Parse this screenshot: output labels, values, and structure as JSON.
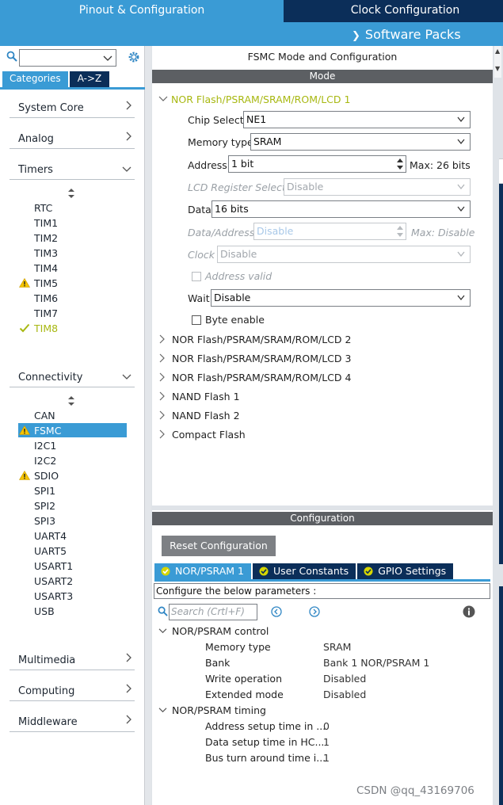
{
  "top_tabs": {
    "pinout": "Pinout & Configuration",
    "clock": "Clock Configuration",
    "software_packs": "Software Packs"
  },
  "left_panel": {
    "category_tabs": [
      "Categories",
      "A->Z"
    ],
    "categories": {
      "system_core": "System Core",
      "analog": "Analog",
      "timers": "Timers",
      "connectivity": "Connectivity",
      "multimedia": "Multimedia",
      "computing": "Computing",
      "middleware": "Middleware"
    },
    "timers": [
      {
        "name": "RTC",
        "status": "none"
      },
      {
        "name": "TIM1",
        "status": "none"
      },
      {
        "name": "TIM2",
        "status": "none"
      },
      {
        "name": "TIM3",
        "status": "none"
      },
      {
        "name": "TIM4",
        "status": "none"
      },
      {
        "name": "TIM5",
        "status": "warning"
      },
      {
        "name": "TIM6",
        "status": "none"
      },
      {
        "name": "TIM7",
        "status": "none"
      },
      {
        "name": "TIM8",
        "status": "ok"
      }
    ],
    "connectivity": [
      {
        "name": "CAN",
        "status": "none"
      },
      {
        "name": "FSMC",
        "status": "warning",
        "selected": true
      },
      {
        "name": "I2C1",
        "status": "none"
      },
      {
        "name": "I2C2",
        "status": "none"
      },
      {
        "name": "SDIO",
        "status": "warning"
      },
      {
        "name": "SPI1",
        "status": "none"
      },
      {
        "name": "SPI2",
        "status": "none"
      },
      {
        "name": "SPI3",
        "status": "none"
      },
      {
        "name": "UART4",
        "status": "none"
      },
      {
        "name": "UART5",
        "status": "none"
      },
      {
        "name": "USART1",
        "status": "none"
      },
      {
        "name": "USART2",
        "status": "none"
      },
      {
        "name": "USART3",
        "status": "none"
      },
      {
        "name": "USB",
        "status": "none"
      }
    ]
  },
  "mode": {
    "title": "FSMC Mode and Configuration",
    "bar": "Mode",
    "nor1": "NOR Flash/PSRAM/SRAM/ROM/LCD 1",
    "chip_select": {
      "label": "Chip Select",
      "value": "NE1"
    },
    "memory_type": {
      "label": "Memory type",
      "value": "SRAM"
    },
    "address": {
      "label": "Address",
      "value": "1 bit",
      "max": "Max: 26 bits"
    },
    "lcd_register_select": {
      "label": "LCD Register Select",
      "value": "Disable"
    },
    "data": {
      "label": "Data",
      "value": "16 bits"
    },
    "data_address": {
      "label": "Data/Address",
      "value": "Disable",
      "max": "Max: Disable"
    },
    "clock": {
      "label": "Clock",
      "value": "Disable"
    },
    "address_valid": {
      "label": "Address valid"
    },
    "wait": {
      "label": "Wait",
      "value": "Disable"
    },
    "byte_enable": {
      "label": "Byte enable"
    },
    "collapsed": [
      "NOR Flash/PSRAM/SRAM/ROM/LCD 2",
      "NOR Flash/PSRAM/SRAM/ROM/LCD 3",
      "NOR Flash/PSRAM/SRAM/ROM/LCD 4",
      "NAND Flash 1",
      "NAND Flash 2",
      "Compact Flash"
    ]
  },
  "config": {
    "bar": "Configuration",
    "reset": "Reset Configuration",
    "tabs": [
      "NOR/PSRAM 1",
      "User Constants",
      "GPIO Settings"
    ],
    "hint": "Configure the below parameters :",
    "search_placeholder": "Search (Crtl+F)",
    "groups": [
      {
        "name": "NOR/PSRAM control",
        "props": [
          {
            "k": "Memory type",
            "v": "SRAM"
          },
          {
            "k": "Bank",
            "v": "Bank 1 NOR/PSRAM 1"
          },
          {
            "k": "Write operation",
            "v": "Disabled"
          },
          {
            "k": "Extended mode",
            "v": "Disabled"
          }
        ]
      },
      {
        "name": "NOR/PSRAM timing",
        "props": [
          {
            "k": "Address setup time in ...",
            "v": "0"
          },
          {
            "k": "Data setup time in HC...",
            "v": "1"
          },
          {
            "k": "Bus turn around time i...",
            "v": "1"
          }
        ]
      }
    ]
  },
  "watermark": "CSDN @qq_43169706",
  "colors": {
    "accent": "#3a9bd5",
    "navy": "#0b2e59",
    "warning": "#f5c400",
    "ok_green": "#a8b812"
  }
}
